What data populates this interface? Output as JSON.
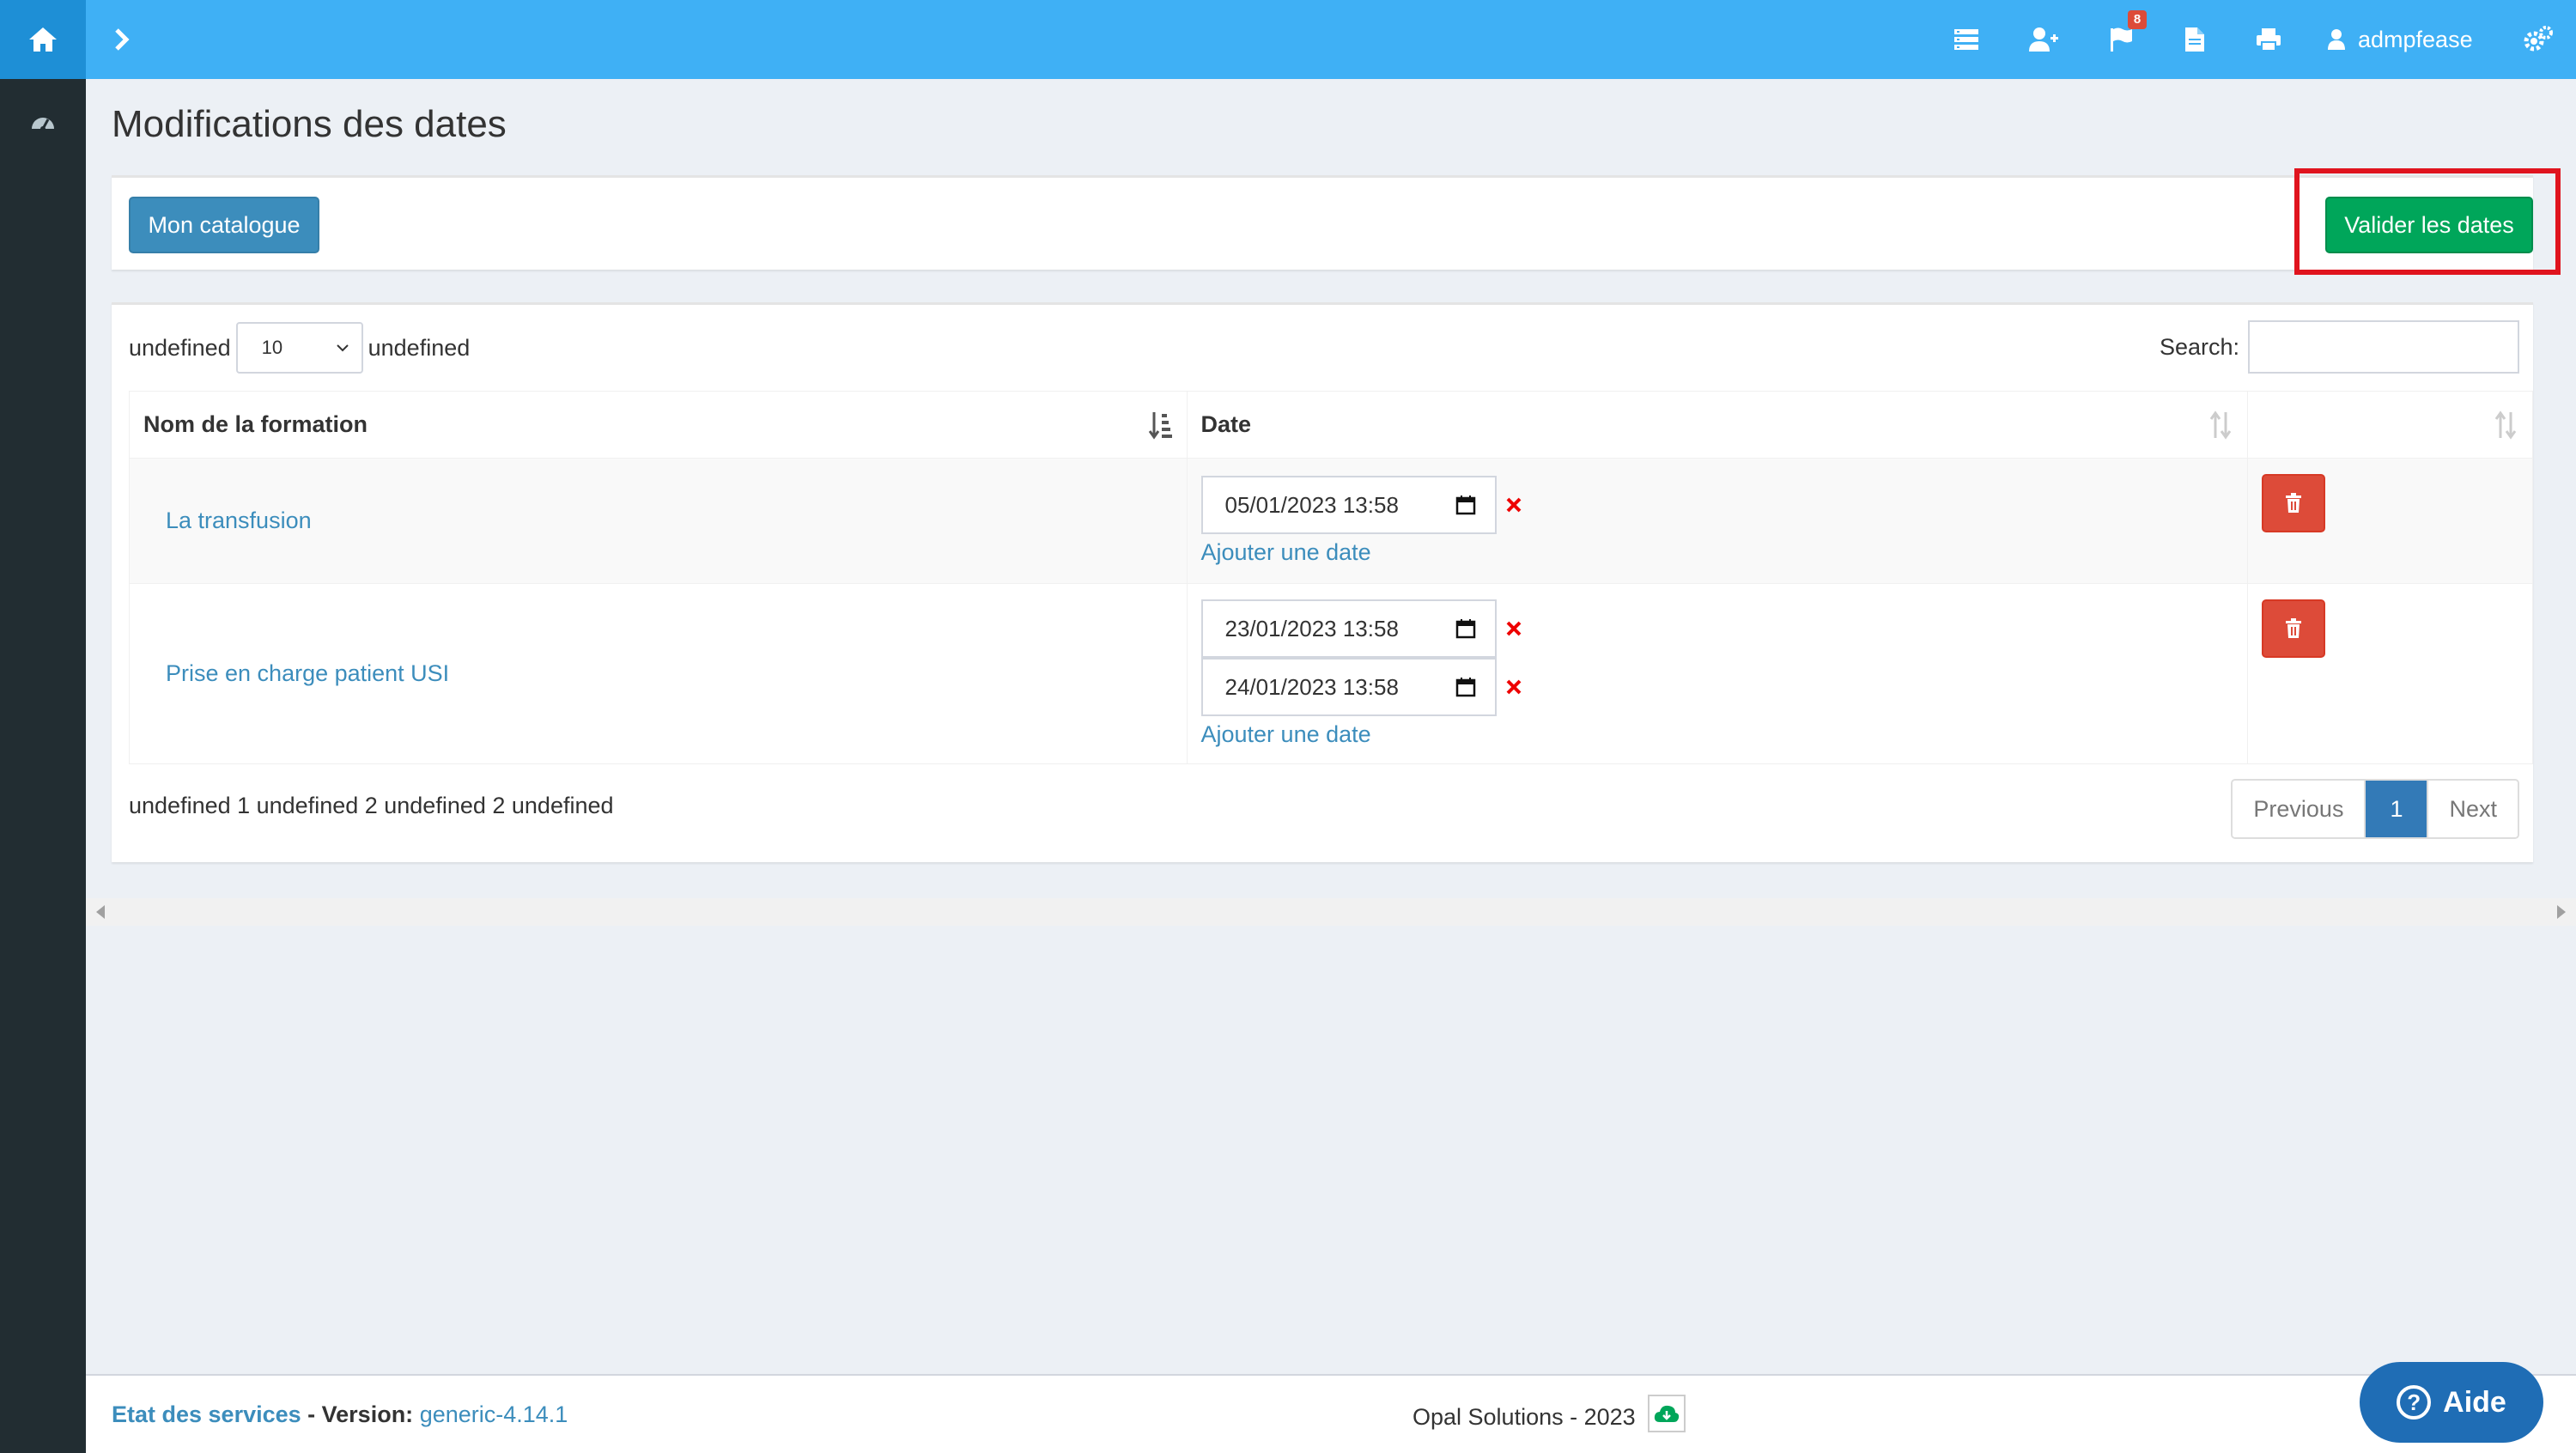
{
  "header": {
    "user_name": "admpfease",
    "notification_count": "8",
    "icons": [
      "home-icon",
      "chevron-right-icon",
      "list-icon",
      "user-plus-icon",
      "flag-icon",
      "file-icon",
      "print-icon",
      "user-icon",
      "cogs-icon"
    ]
  },
  "sidebar": {
    "icons": [
      "dashboard-icon"
    ]
  },
  "page": {
    "title": "Modifications des dates"
  },
  "toolbar": {
    "catalogue_label": "Mon catalogue",
    "valider_label": "Valider les dates"
  },
  "datatable": {
    "length_prefix": "undefined",
    "length_value": "10",
    "length_suffix": "undefined",
    "search_label": "Search:",
    "search_value": "",
    "columns": [
      "Nom de la formation",
      "Date",
      ""
    ],
    "rows": [
      {
        "name": "La transfusion",
        "dates": [
          "05/01/2023 13:58"
        ],
        "add_label": "Ajouter une date"
      },
      {
        "name": "Prise en charge patient USI",
        "dates": [
          "23/01/2023 13:58",
          "24/01/2023 13:58"
        ],
        "add_label": "Ajouter une date"
      }
    ],
    "info": "undefined 1 undefined 2 undefined 2 undefined",
    "pagination": {
      "previous": "Previous",
      "current": "1",
      "next": "Next"
    }
  },
  "footer": {
    "etat_label": "Etat des services",
    "separator": " - ",
    "version_label": "Version:",
    "version_value": "generic-4.14.1",
    "copyright": "Opal Solutions - 2023",
    "aide_label": "Aide"
  },
  "colors": {
    "topbar": "#3fb0f5",
    "sidebar": "#222d32",
    "primary": "#3c8dbc",
    "success": "#00a65a",
    "danger": "#dd4b39",
    "highlight": "#e0141e"
  }
}
